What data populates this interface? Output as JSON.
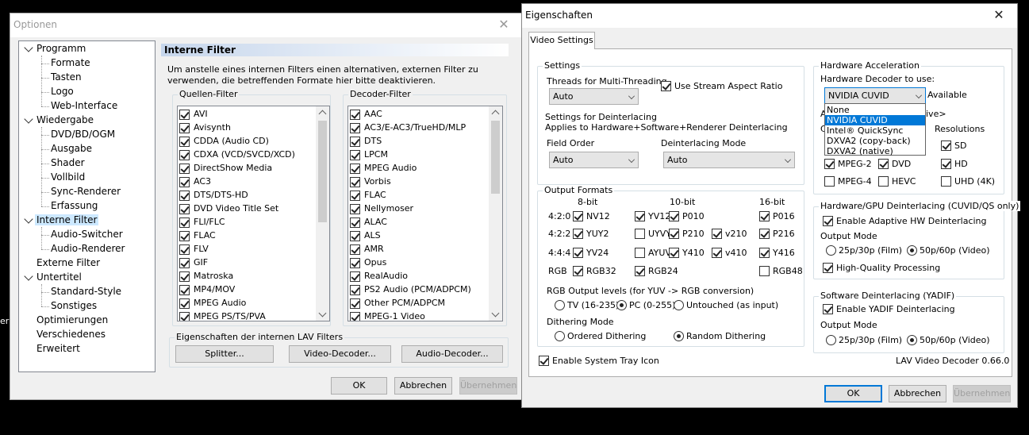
{
  "optionen": {
    "title": "Optionen",
    "tree": [
      {
        "label": "Programm",
        "level": 0,
        "expanded": true
      },
      {
        "label": "Formate",
        "level": 1
      },
      {
        "label": "Tasten",
        "level": 1
      },
      {
        "label": "Logo",
        "level": 1
      },
      {
        "label": "Web-Interface",
        "level": 1
      },
      {
        "label": "Wiedergabe",
        "level": 0,
        "expanded": true
      },
      {
        "label": "DVD/BD/OGM",
        "level": 1
      },
      {
        "label": "Ausgabe",
        "level": 1
      },
      {
        "label": "Shader",
        "level": 1
      },
      {
        "label": "Vollbild",
        "level": 1
      },
      {
        "label": "Sync-Renderer",
        "level": 1
      },
      {
        "label": "Erfassung",
        "level": 1
      },
      {
        "label": "Interne Filter",
        "level": 0,
        "expanded": true,
        "selected": true
      },
      {
        "label": "Audio-Switcher",
        "level": 1
      },
      {
        "label": "Audio-Renderer",
        "level": 1
      },
      {
        "label": "Externe Filter",
        "level": 0
      },
      {
        "label": "Untertitel",
        "level": 0,
        "expanded": true
      },
      {
        "label": "Standard-Style",
        "level": 1
      },
      {
        "label": "Sonstiges",
        "level": 1
      },
      {
        "label": "Optimierungen",
        "level": 0
      },
      {
        "label": "Verschiedenes",
        "level": 0
      },
      {
        "label": "Erweitert",
        "level": 0
      }
    ],
    "header": "Interne Filter",
    "description": "Um anstelle eines internen Filters einen alternativen, externen Filter zu verwenden, die betreffenden Formate hier bitte deaktivieren.",
    "source_label": "Quellen-Filter",
    "source_items": [
      "AVI",
      "Avisynth",
      "CDDA (Audio CD)",
      "CDXA (VCD/SVCD/XCD)",
      "DirectShow Media",
      "AC3",
      "DTS/DTS-HD",
      "DVD Video Title Set",
      "FLI/FLC",
      "FLAC",
      "FLV",
      "GIF",
      "Matroska",
      "MP4/MOV",
      "MPEG Audio",
      "MPEG PS/TS/PVA"
    ],
    "decoder_label": "Decoder-Filter",
    "decoder_items": [
      "AAC",
      "AC3/E-AC3/TrueHD/MLP",
      "DTS",
      "LPCM",
      "MPEG Audio",
      "Vorbis",
      "FLAC",
      "Nellymoser",
      "ALAC",
      "ALS",
      "AMR",
      "Opus",
      "RealAudio",
      "PS2 Audio (PCM/ADPCM)",
      "Other PCM/ADPCM",
      "MPEG-1 Video"
    ],
    "lav_label": "Eigenschaften der internen LAV Filters",
    "splitter": "Splitter...",
    "video_decoder": "Video-Decoder...",
    "audio_decoder": "Audio-Decoder...",
    "ok": "OK",
    "cancel": "Abbrechen",
    "apply": "Übernehmen"
  },
  "eig": {
    "title": "Eigenschaften",
    "tab": "Video Settings",
    "settings_label": "Settings",
    "threads_label": "Threads for Multi-Threading",
    "threads_value": "Auto",
    "aspect_label": "Use Stream Aspect Ratio",
    "deint_label1": "Settings for Deinterlacing",
    "deint_label2": "Applies to Hardware+Software+Renderer Deinterlacing",
    "field_order_label": "Field Order",
    "field_order_value": "Auto",
    "deint_mode_label": "Deinterlacing Mode",
    "deint_mode_value": "Auto",
    "output_label": "Output Formats",
    "col_8bit": "8-bit",
    "col_10bit": "10-bit",
    "col_16bit": "16-bit",
    "row_420": "4:2:0",
    "row_422": "4:2:2",
    "row_444": "4:4:4",
    "row_rgb": "RGB",
    "fmt": {
      "nv12": "NV12",
      "yv12": "YV12",
      "p010": "P010",
      "p016": "P016",
      "yuy2": "YUY2",
      "uyvy": "UYVY",
      "p210": "P210",
      "v210": "v210",
      "p216": "P216",
      "yv24": "YV24",
      "ayuv": "AYUV",
      "y410": "Y410",
      "v410": "v410",
      "y416": "Y416",
      "rgb32": "RGB32",
      "rgb24": "RGB24",
      "rgb48": "RGB48"
    },
    "rgb_levels_label": "RGB Output levels (for YUV -> RGB conversion)",
    "tv": "TV (16-235)",
    "pc": "PC (0-255)",
    "untouched": "Untouched (as input)",
    "dither_label": "Dithering Mode",
    "ordered": "Ordered Dithering",
    "random": "Random Dithering",
    "tray": "Enable System Tray Icon",
    "hw_label": "Hardware Acceleration",
    "hw_decoder_label": "Hardware Decoder to use:",
    "hw_decoder_value": "NVIDIA CUVID",
    "available": "Available",
    "dropdown": [
      "None",
      "NVIDIA CUVID",
      "Intel® QuickSync",
      "DXVA2 (copy-back)",
      "DXVA2 (native)"
    ],
    "partial_a": "A",
    "partial_c": "C",
    "partial_ive": "ive>",
    "resolutions": "Resolutions",
    "sd": "SD",
    "mpeg2": "MPEG-2",
    "dvd": "DVD",
    "hd": "HD",
    "mpeg4": "MPEG-4",
    "hevc": "HEVC",
    "uhd": "UHD (4K)",
    "hwdeint_label": "Hardware/GPU Deinterlacing (CUVID/QS only)",
    "adaptive": "Enable Adaptive HW Deinterlacing",
    "output_mode": "Output Mode",
    "film": "25p/30p (Film)",
    "video": "50p/60p (Video)",
    "hq": "High-Quality Processing",
    "swdeint_label": "Software Deinterlacing (YADIF)",
    "yadif": "Enable YADIF Deinterlacing",
    "output_mode2": "Output Mode",
    "film2": "25p/30p (Film)",
    "video2": "50p/60p (Video)",
    "version": "LAV Video Decoder 0.66.0",
    "ok": "OK",
    "cancel": "Abbrechen",
    "apply": "Übernehmen"
  },
  "bg": {
    "left_fragment": "er"
  }
}
